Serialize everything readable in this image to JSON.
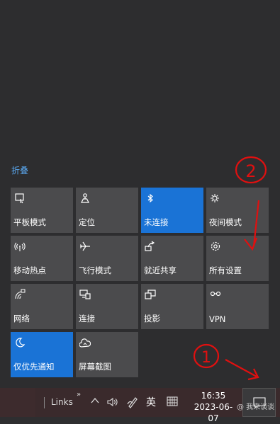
{
  "action_center": {
    "collapse_label": "折叠",
    "tiles": [
      {
        "label": "平板模式",
        "icon": "tablet-mode-icon",
        "on": false
      },
      {
        "label": "定位",
        "icon": "location-icon",
        "on": false
      },
      {
        "label": "未连接",
        "icon": "bluetooth-icon",
        "on": true
      },
      {
        "label": "夜间模式",
        "icon": "night-light-icon",
        "on": false
      },
      {
        "label": "移动热点",
        "icon": "mobile-hotspot-icon",
        "on": false
      },
      {
        "label": "飞行模式",
        "icon": "airplane-icon",
        "on": false
      },
      {
        "label": "就近共享",
        "icon": "nearby-share-icon",
        "on": false
      },
      {
        "label": "所有设置",
        "icon": "gear-icon",
        "on": false
      },
      {
        "label": "网络",
        "icon": "network-icon",
        "on": false
      },
      {
        "label": "连接",
        "icon": "connect-icon",
        "on": false
      },
      {
        "label": "投影",
        "icon": "project-icon",
        "on": false
      },
      {
        "label": "VPN",
        "icon": "vpn-icon",
        "on": false
      },
      {
        "label": "仅优先通知",
        "icon": "focus-assist-icon",
        "on": true
      },
      {
        "label": "屏幕截图",
        "icon": "screenshot-icon",
        "on": false
      }
    ]
  },
  "taskbar": {
    "links_label": "Links",
    "chevron": "»",
    "ime_label": "英",
    "time": "16:35",
    "date": "2023-06-07"
  },
  "watermark": "@ 我来谈谈",
  "colors": {
    "accent": "#1a73d6",
    "tile": "#4b4b4d",
    "annotation": "#e01010"
  },
  "annotations": {
    "label_1": "1",
    "label_2": "2"
  }
}
